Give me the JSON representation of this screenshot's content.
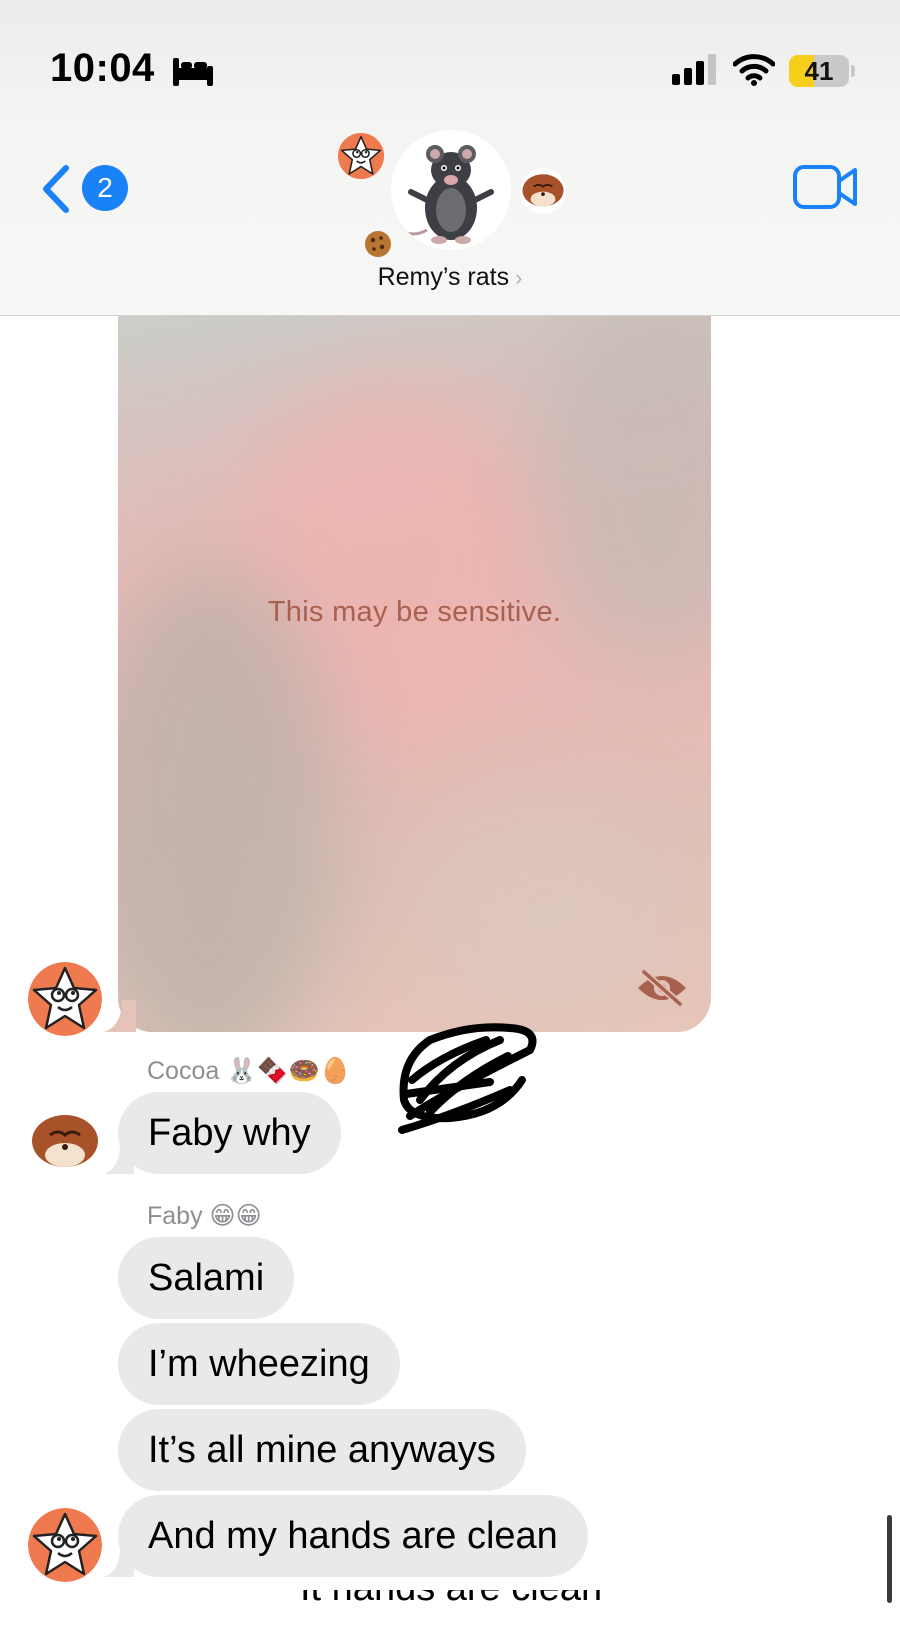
{
  "status_bar": {
    "time": "10:04",
    "focus_icon": "bed-icon",
    "signal_icon": "cellular-signal-icon",
    "wifi_icon": "wifi-icon",
    "battery_percent": "41",
    "battery_level": 0.41,
    "battery_color": "#f5cf1b"
  },
  "header": {
    "back_badge": "2",
    "group_name": "Remy’s rats",
    "title_chevron": "›",
    "video_icon": "video-camera-icon",
    "accent_color": "#1a82f7"
  },
  "messages": {
    "sensitive_image": {
      "notice": "This may be sensitive.",
      "reveal_icon": "eye-slash-icon"
    },
    "cocoa": {
      "sender": "Cocoa 🐰🍫🍩🥚",
      "text": "Faby why"
    },
    "faby": {
      "sender": "Faby 😁😁",
      "bubbles": [
        "Salami",
        "I’m wheezing",
        "It’s all mine anyways",
        "And my hands are clean"
      ]
    },
    "partial_next": "It hands are clean"
  },
  "colors": {
    "incoming_bubble": "#e9e9eb",
    "sender_label": "#8e8e93",
    "sensitive_text": "#a8604f"
  }
}
